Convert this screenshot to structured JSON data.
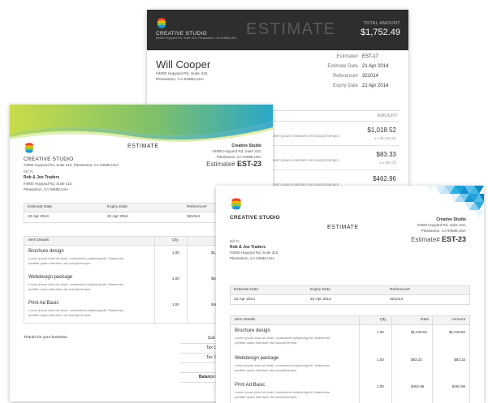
{
  "colors": {
    "dark_header": "#2e2e2e",
    "wave_green": "#a8cf3c",
    "wave_teal": "#2aa7c9",
    "triangle_blue": "#1ea2d9",
    "logo_red": "#e8442f",
    "logo_yellow": "#f5b400",
    "logo_green": "#8cc63f",
    "logo_blue": "#1e9ad6"
  },
  "back": {
    "company": "CREATIVE STUDIO",
    "company_addr": "#4900 Hopyard Rd, Suite 310, Pleasanton, CA 94588,USA",
    "title": "ESTIMATE",
    "total_label": "TOTAL AMOUNT",
    "total_value": "$1,752.49",
    "client_name": "Will Cooper",
    "client_addr1": "#4900 Hopyard Rd, Suite 310,",
    "client_addr2": "Pleasanton, CA 94588,USA",
    "meta": [
      {
        "label": "Estimate#",
        "value": "EST-17"
      },
      {
        "label": "Estimate Date",
        "value": "21 Apr 2014"
      },
      {
        "label": "Reference#",
        "value": "321014"
      },
      {
        "label": "Expiry Date",
        "value": "21 Apr 2014"
      }
    ],
    "amount_header": "AMOUNT",
    "items": [
      {
        "desc": "Lorem ipsum interdum nisl suscipit tempor.",
        "amount": "$1,018.52",
        "sub": "1 x $1,018.52"
      },
      {
        "desc": "Lorem ipsum interdum nisl suscipit tempor.",
        "amount": "$83.33",
        "sub": "1 x $83.33"
      },
      {
        "desc": "Lorem ipsum interdum nisl suscipit tempor.",
        "amount": "$462.96",
        "sub": "1 x $462.96"
      }
    ]
  },
  "left": {
    "company": "CREATIVE STUDIO",
    "company_addr": "#4900 Hopyard Rd, Suite 310, Pleasanton, CA 94588,USA",
    "title": "ESTIMATE",
    "r_company": "Creative Studio",
    "r_addr1": "#4900 Hopyard Rd, Suite 310,",
    "r_addr2": "Pleasanton, CA 94588,USA",
    "est_label": "Estimate#",
    "est_number": "EST-23",
    "bill_to": "Bill To",
    "client": "Rob & Joe Traders",
    "client_addr1": "#4900 Hopyard Rd, Suite 310,",
    "client_addr2": "Pleasanton, CA 94588,USA",
    "meta_headers": [
      "Estimate Date",
      "Expiry Date",
      "Reference#"
    ],
    "meta_values": [
      "22 Apr 2014",
      "22 Apr 2014",
      "321014"
    ],
    "item_headers": [
      "Item Details",
      "Qty",
      "Rate"
    ],
    "items": [
      {
        "name": "Brochure design",
        "d1": "Lorem ipsum dolor sit amet, consectetur adipiscing elit. Maecenas",
        "d2": "porttitor quam interdum nisl suscipit tempor.",
        "qty": "1.00",
        "rate": "$1,018.52"
      },
      {
        "name": "Webdesign package",
        "d1": "Lorem ipsum dolor sit amet, consectetur adipiscing elit. Maecenas",
        "d2": "porttitor quam interdum nisl suscipit tempor.",
        "qty": "1.00",
        "rate": "$83.33"
      },
      {
        "name": "Print Ad Basic",
        "d1": "Lorem ipsum dolor sit amet, consectetur adipiscing elit. Maecenas",
        "d2": "porttitor quam interdum nisl suscipit tempor.",
        "qty": "1.00",
        "rate": "$462.96"
      }
    ],
    "thanks": "Thanks for your business",
    "totals": [
      "Sub T",
      "Tax 1 (",
      "Tax 2 (",
      "T",
      "Balance D"
    ]
  },
  "front": {
    "company": "CREATIVE STUDIO",
    "title": "ESTIMATE",
    "r_company": "Creative Studio",
    "r_addr1": "#4900 Hopyard Rd, Suite 310,",
    "r_addr2": "Pleasanton, CA 94588,USA",
    "est_label": "Estimate#",
    "est_number": "EST-23",
    "bill_to": "Bill To",
    "client": "Rob & Joe Traders",
    "client_addr1": "#4900 Hopyard Rd, Suite 310,",
    "client_addr2": "Pleasanton, CA 94588,USA",
    "meta_headers": [
      "Estimate Date",
      "Expiry Date",
      "Reference#"
    ],
    "meta_values": [
      "22 Apr 2014",
      "22 Apr 2014",
      "321014"
    ],
    "item_headers": [
      "Item Details",
      "Qty",
      "Rate",
      "Amount"
    ],
    "items": [
      {
        "name": "Brochure design",
        "d1": "Lorem ipsum dolor sit amet, consectetur adipiscing elit. Maecenas",
        "d2": "porttitor quam interdum nisl suscipit tempor.",
        "qty": "1.00",
        "rate": "$1,018.52",
        "amount": "$1,018.52"
      },
      {
        "name": "Webdesign package",
        "d1": "Lorem ipsum dolor sit amet, consectetur adipiscing elit. Maecenas",
        "d2": "porttitor quam interdum nisl suscipit tempor.",
        "qty": "1.00",
        "rate": "$83.33",
        "amount": "$83.33"
      },
      {
        "name": "Print Ad Basic",
        "d1": "Lorem ipsum dolor sit amet, consectetur adipiscing elit. Maecenas",
        "d2": "porttitor quam interdum nisl suscipit tempor.",
        "qty": "1.00",
        "rate": "$462.96",
        "amount": "$462.96"
      }
    ]
  }
}
